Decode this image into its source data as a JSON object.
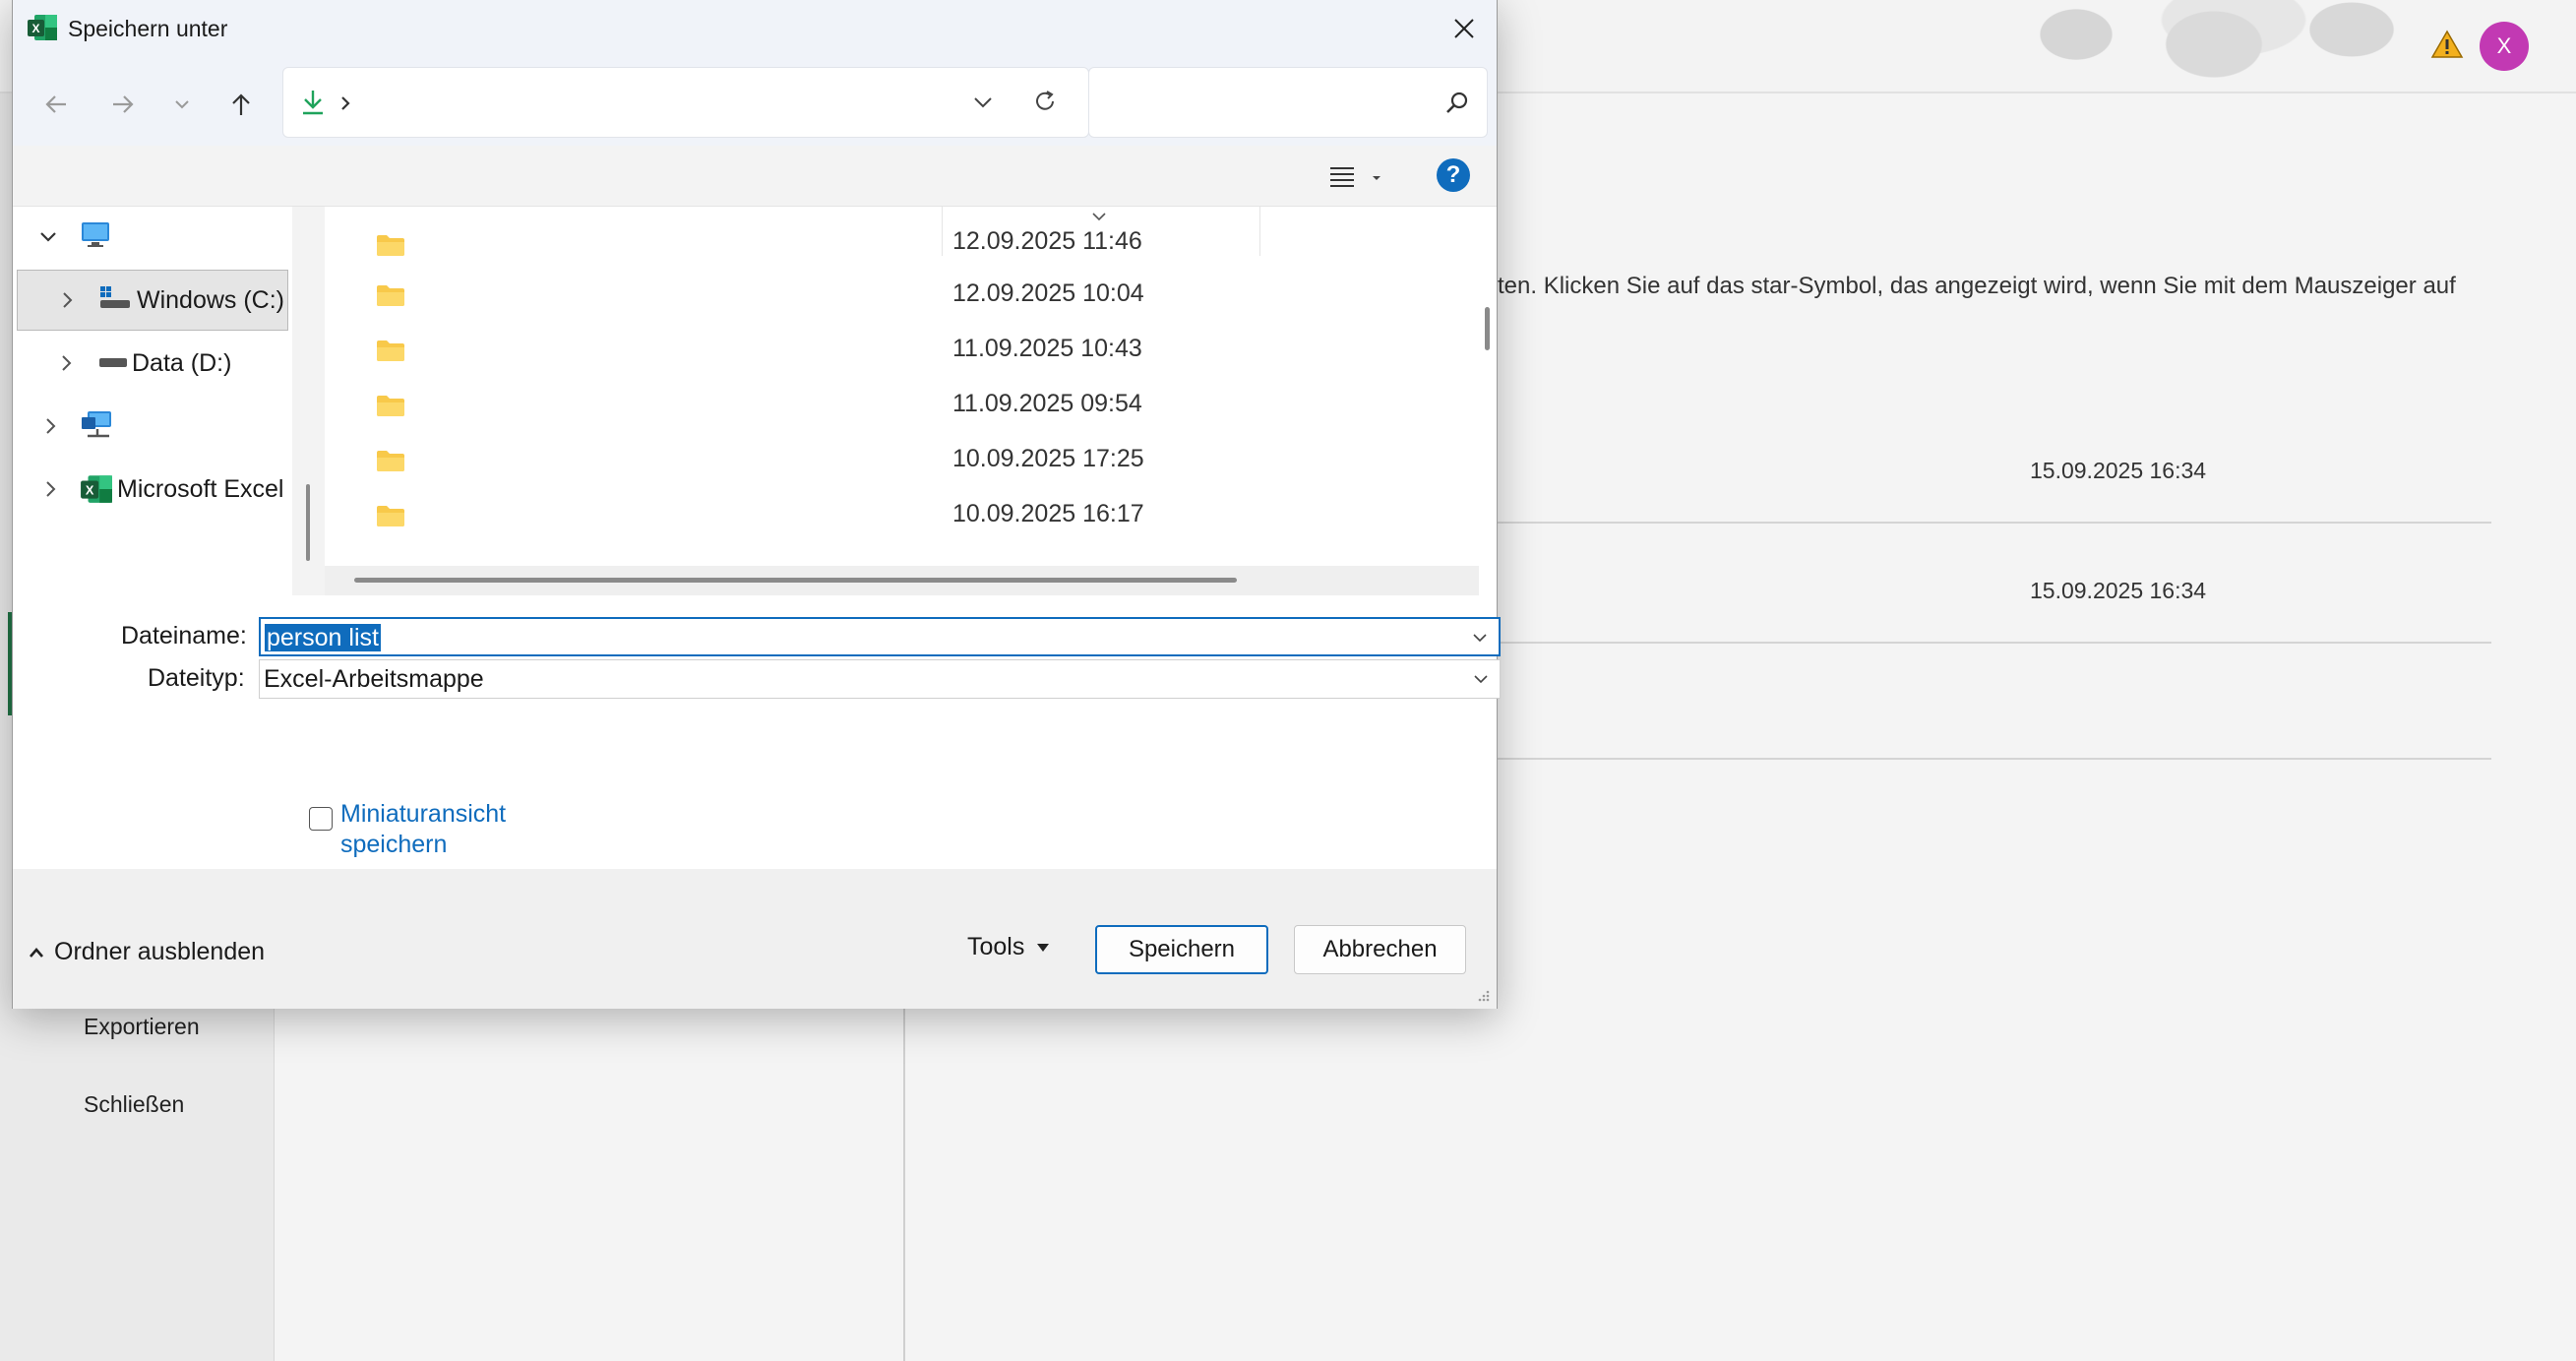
{
  "background": {
    "avatar_initial": "X",
    "info_text": "ten. Klicken Sie auf das star-Symbol, das angezeigt wird, wenn Sie mit dem Mauszeiger auf",
    "dates": [
      "15.09.2025 16:34",
      "15.09.2025 16:34"
    ],
    "nav": {
      "export": "Exportieren",
      "close": "Schließen"
    }
  },
  "dialog": {
    "title": "Speichern unter",
    "address": {
      "current_folder": "",
      "search_placeholder": ""
    },
    "tree": [
      {
        "label": "",
        "icon": "computer-icon",
        "expanded": true
      },
      {
        "label": "Windows (C:)",
        "icon": "windows-drive-icon",
        "selected": true
      },
      {
        "label": "Data (D:)",
        "icon": "drive-icon"
      },
      {
        "label": "",
        "icon": "network-icon"
      },
      {
        "label": "Microsoft Excel",
        "icon": "excel-icon"
      }
    ],
    "files": [
      {
        "name": "",
        "date": "12.09.2025 11:46"
      },
      {
        "name": "",
        "date": "12.09.2025 10:04"
      },
      {
        "name": "",
        "date": "11.09.2025 10:43"
      },
      {
        "name": "",
        "date": "11.09.2025 09:54"
      },
      {
        "name": "",
        "date": "10.09.2025 17:25"
      },
      {
        "name": "",
        "date": "10.09.2025 16:17"
      }
    ],
    "filename_label": "Dateiname:",
    "filename_value": "person list",
    "filetype_label": "Dateityp:",
    "filetype_value": "Excel-Arbeitsmappe",
    "thumbnail_label": "Miniaturansicht speichern",
    "thumbnail_checked": false,
    "hide_folders_label": "Ordner ausblenden",
    "tools_label": "Tools",
    "save_label": "Speichern",
    "cancel_label": "Abbrechen"
  },
  "colors": {
    "accent": "#0f6cbd",
    "excel_green": "#217346",
    "avatar": "#c239b3",
    "folder": "#f8c94a"
  }
}
